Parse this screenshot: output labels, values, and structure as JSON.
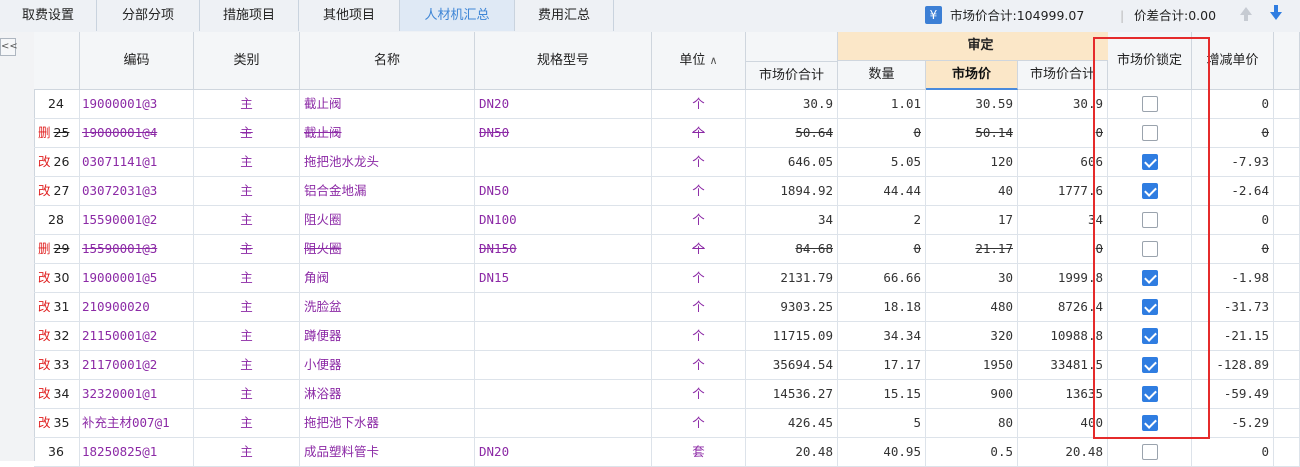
{
  "tabs": [
    {
      "label": "取费设置",
      "active": false
    },
    {
      "label": "分部分项",
      "active": false
    },
    {
      "label": "措施项目",
      "active": false
    },
    {
      "label": "其他项目",
      "active": false
    },
    {
      "label": "人材机汇总",
      "active": true
    },
    {
      "label": "费用汇总",
      "active": false
    }
  ],
  "totals": {
    "market_label": "市场价合计:104999.07",
    "diff_label": "价差合计:0.00"
  },
  "icons": {
    "currency": "yen-icon",
    "up": "arrow-up-icon",
    "down": "arrow-down-icon",
    "collapse": "collapse-left-icon"
  },
  "collapse_label": "<<",
  "columns": {
    "code": "编码",
    "type": "类别",
    "name": "名称",
    "spec": "规格型号",
    "unit": "单位",
    "market_total": "市场价合计",
    "group": "审定",
    "qty": "数量",
    "market_price": "市场价",
    "group_market_total": "市场价合计",
    "lock": "市场价锁定",
    "adj_price": "增减单价"
  },
  "sort_indicator": "^",
  "colors": {
    "accent": "#2f7de1",
    "purple_text": "#8c2aa6",
    "mark_red": "#e02020",
    "highlight_box": "#e52b2b",
    "group_header": "#fbe7c8"
  },
  "rows": [
    {
      "mark": "",
      "idx": "24",
      "code": "19000001@3",
      "type": "主",
      "name": "截止阀",
      "spec": "DN20",
      "unit": "个",
      "market_total": "30.9",
      "qty": "1.01",
      "price": "30.59",
      "group_total": "30.9",
      "locked": false,
      "adj": "0",
      "deleted": false
    },
    {
      "mark": "删",
      "idx": "25",
      "code": "19000001@4",
      "type": "主",
      "name": "截止阀",
      "spec": "DN50",
      "unit": "个",
      "market_total": "50.64",
      "qty": "0",
      "price": "50.14",
      "group_total": "0",
      "locked": false,
      "adj": "0",
      "deleted": true
    },
    {
      "mark": "改",
      "idx": "26",
      "code": "03071141@1",
      "type": "主",
      "name": "拖把池水龙头",
      "spec": "",
      "unit": "个",
      "market_total": "646.05",
      "qty": "5.05",
      "price": "120",
      "group_total": "606",
      "locked": true,
      "adj": "-7.93",
      "deleted": false
    },
    {
      "mark": "改",
      "idx": "27",
      "code": "03072031@3",
      "type": "主",
      "name": "铝合金地漏",
      "spec": "DN50",
      "unit": "个",
      "market_total": "1894.92",
      "qty": "44.44",
      "price": "40",
      "group_total": "1777.6",
      "locked": true,
      "adj": "-2.64",
      "deleted": false
    },
    {
      "mark": "",
      "idx": "28",
      "code": "15590001@2",
      "type": "主",
      "name": "阻火圈",
      "spec": "DN100",
      "unit": "个",
      "market_total": "34",
      "qty": "2",
      "price": "17",
      "group_total": "34",
      "locked": false,
      "adj": "0",
      "deleted": false
    },
    {
      "mark": "删",
      "idx": "29",
      "code": "15590001@3",
      "type": "主",
      "name": "阻火圈",
      "spec": "DN150",
      "unit": "个",
      "market_total": "84.68",
      "qty": "0",
      "price": "21.17",
      "group_total": "0",
      "locked": false,
      "adj": "0",
      "deleted": true
    },
    {
      "mark": "改",
      "idx": "30",
      "code": "19000001@5",
      "type": "主",
      "name": "角阀",
      "spec": "DN15",
      "unit": "个",
      "market_total": "2131.79",
      "qty": "66.66",
      "price": "30",
      "group_total": "1999.8",
      "locked": true,
      "adj": "-1.98",
      "deleted": false
    },
    {
      "mark": "改",
      "idx": "31",
      "code": "210900020",
      "type": "主",
      "name": "洗脸盆",
      "spec": "",
      "unit": "个",
      "market_total": "9303.25",
      "qty": "18.18",
      "price": "480",
      "group_total": "8726.4",
      "locked": true,
      "adj": "-31.73",
      "deleted": false
    },
    {
      "mark": "改",
      "idx": "32",
      "code": "21150001@2",
      "type": "主",
      "name": "蹲便器",
      "spec": "",
      "unit": "个",
      "market_total": "11715.09",
      "qty": "34.34",
      "price": "320",
      "group_total": "10988.8",
      "locked": true,
      "adj": "-21.15",
      "deleted": false
    },
    {
      "mark": "改",
      "idx": "33",
      "code": "21170001@2",
      "type": "主",
      "name": "小便器",
      "spec": "",
      "unit": "个",
      "market_total": "35694.54",
      "qty": "17.17",
      "price": "1950",
      "group_total": "33481.5",
      "locked": true,
      "adj": "-128.89",
      "deleted": false
    },
    {
      "mark": "改",
      "idx": "34",
      "code": "32320001@1",
      "type": "主",
      "name": "淋浴器",
      "spec": "",
      "unit": "个",
      "market_total": "14536.27",
      "qty": "15.15",
      "price": "900",
      "group_total": "13635",
      "locked": true,
      "adj": "-59.49",
      "deleted": false
    },
    {
      "mark": "改",
      "idx": "35",
      "code": "补充主材007@1",
      "type": "主",
      "name": "拖把池下水器",
      "spec": "",
      "unit": "个",
      "market_total": "426.45",
      "qty": "5",
      "price": "80",
      "group_total": "400",
      "locked": true,
      "adj": "-5.29",
      "deleted": false
    },
    {
      "mark": "",
      "idx": "36",
      "code": "18250825@1",
      "type": "主",
      "name": "成品塑料管卡",
      "spec": "DN20",
      "unit": "套",
      "market_total": "20.48",
      "qty": "40.95",
      "price": "0.5",
      "group_total": "20.48",
      "locked": false,
      "adj": "0",
      "deleted": false
    }
  ]
}
